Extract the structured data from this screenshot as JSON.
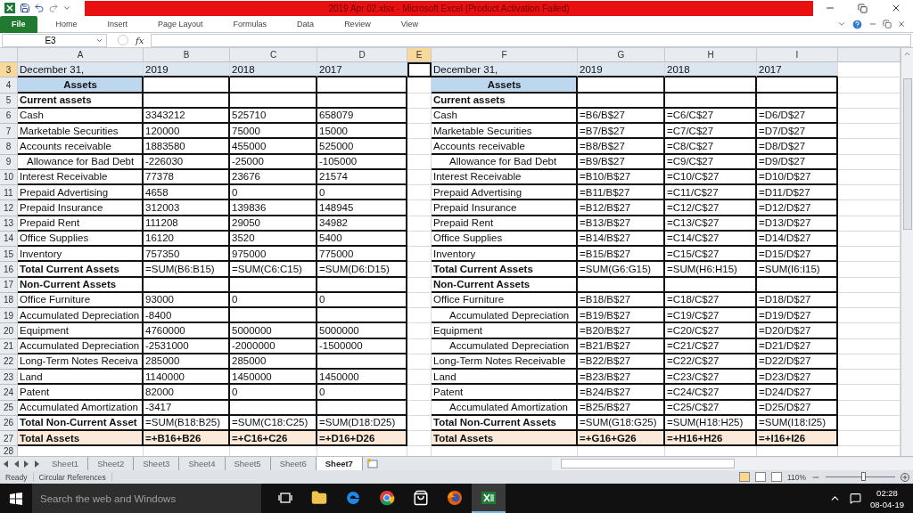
{
  "window": {
    "title": "2019 Apr 02.xlsx  -  Microsoft Excel (Product Activation Failed)"
  },
  "ribbon": {
    "tabs": [
      {
        "label": "File",
        "selected": true
      },
      {
        "label": "Home",
        "selected": false
      },
      {
        "label": "Insert",
        "selected": false
      },
      {
        "label": "Page Layout",
        "selected": false
      },
      {
        "label": "Formulas",
        "selected": false
      },
      {
        "label": "Data",
        "selected": false
      },
      {
        "label": "Review",
        "selected": false
      },
      {
        "label": "View",
        "selected": false
      }
    ]
  },
  "formula_bar": {
    "name_box": "E3",
    "function_label": "fx"
  },
  "columns": [
    {
      "label": "A",
      "selected": false
    },
    {
      "label": "B",
      "selected": false
    },
    {
      "label": "C",
      "selected": false
    },
    {
      "label": "D",
      "selected": false
    },
    {
      "label": "E",
      "selected": true
    },
    {
      "label": "F",
      "selected": false
    },
    {
      "label": "G",
      "selected": false
    },
    {
      "label": "H",
      "selected": false
    },
    {
      "label": "I",
      "selected": false
    }
  ],
  "rows": [
    {
      "number": "3",
      "kind": "header",
      "selected": true,
      "left": {
        "indent": false,
        "cells": [
          "December 31,",
          "2019",
          "2018",
          "2017"
        ]
      },
      "right": {
        "indent": false,
        "cells": [
          "December 31,",
          "2019",
          "2018",
          "2017"
        ]
      }
    },
    {
      "number": "4",
      "kind": "section",
      "selected": false,
      "left": {
        "indent": false,
        "cells": [
          "Assets",
          null,
          null,
          null
        ]
      },
      "right": {
        "indent": false,
        "cells": [
          "Assets",
          null,
          null,
          null
        ]
      }
    },
    {
      "number": "5",
      "kind": "subtotal",
      "selected": false,
      "left": {
        "indent": false,
        "cells": [
          "Current assets",
          null,
          null,
          null
        ]
      },
      "right": {
        "indent": false,
        "cells": [
          "Current assets",
          null,
          null,
          null
        ]
      }
    },
    {
      "number": "6",
      "kind": "plain",
      "selected": false,
      "left": {
        "indent": false,
        "cells": [
          "Cash",
          "3343212",
          "525710",
          "658079"
        ]
      },
      "right": {
        "indent": false,
        "cells": [
          "Cash",
          "=B6/B$27",
          "=C6/C$27",
          "=D6/D$27"
        ]
      }
    },
    {
      "number": "7",
      "kind": "plain",
      "selected": false,
      "left": {
        "indent": false,
        "cells": [
          "Marketable Securities",
          "120000",
          "75000",
          "15000"
        ]
      },
      "right": {
        "indent": false,
        "cells": [
          "Marketable Securities",
          "=B7/B$27",
          "=C7/C$27",
          "=D7/D$27"
        ]
      }
    },
    {
      "number": "8",
      "kind": "plain",
      "selected": false,
      "left": {
        "indent": false,
        "cells": [
          "Accounts receivable",
          "1883580",
          "455000",
          "525000"
        ]
      },
      "right": {
        "indent": false,
        "cells": [
          "Accounts receivable",
          "=B8/B$27",
          "=C8/C$27",
          "=D8/D$27"
        ]
      }
    },
    {
      "number": "9",
      "kind": "plain",
      "selected": false,
      "left": {
        "indent": true,
        "cells": [
          "Allowance for Bad Debt",
          "-226030",
          "-25000",
          "-105000"
        ]
      },
      "right": {
        "indent": true,
        "cells": [
          "Allowance for Bad Debt",
          "=B9/B$27",
          "=C9/C$27",
          "=D9/D$27"
        ]
      }
    },
    {
      "number": "10",
      "kind": "plain",
      "selected": false,
      "left": {
        "indent": false,
        "cells": [
          "Interest Receivable",
          "77378",
          "23676",
          "21574"
        ]
      },
      "right": {
        "indent": false,
        "cells": [
          "Interest Receivable",
          "=B10/B$27",
          "=C10/C$27",
          "=D10/D$27"
        ]
      }
    },
    {
      "number": "11",
      "kind": "plain",
      "selected": false,
      "left": {
        "indent": false,
        "cells": [
          "Prepaid Advertising",
          "4658",
          "0",
          "0"
        ]
      },
      "right": {
        "indent": false,
        "cells": [
          "Prepaid Advertising",
          "=B11/B$27",
          "=C11/C$27",
          "=D11/D$27"
        ]
      }
    },
    {
      "number": "12",
      "kind": "plain",
      "selected": false,
      "left": {
        "indent": false,
        "cells": [
          "Prepaid Insurance",
          "312003",
          "139836",
          "148945"
        ]
      },
      "right": {
        "indent": false,
        "cells": [
          "Prepaid Insurance",
          "=B12/B$27",
          "=C12/C$27",
          "=D12/D$27"
        ]
      }
    },
    {
      "number": "13",
      "kind": "plain",
      "selected": false,
      "left": {
        "indent": false,
        "cells": [
          "Prepaid Rent",
          "111208",
          "29050",
          "34982"
        ]
      },
      "right": {
        "indent": false,
        "cells": [
          "Prepaid Rent",
          "=B13/B$27",
          "=C13/C$27",
          "=D13/D$27"
        ]
      }
    },
    {
      "number": "14",
      "kind": "plain",
      "selected": false,
      "left": {
        "indent": false,
        "cells": [
          "Office Supplies",
          "16120",
          "3520",
          "5400"
        ]
      },
      "right": {
        "indent": false,
        "cells": [
          "Office Supplies",
          "=B14/B$27",
          "=C14/C$27",
          "=D14/D$27"
        ]
      }
    },
    {
      "number": "15",
      "kind": "plain",
      "selected": false,
      "left": {
        "indent": false,
        "cells": [
          "Inventory",
          "757350",
          "975000",
          "775000"
        ]
      },
      "right": {
        "indent": false,
        "cells": [
          "Inventory",
          "=B15/B$27",
          "=C15/C$27",
          "=D15/D$27"
        ]
      }
    },
    {
      "number": "16",
      "kind": "subtotal",
      "selected": false,
      "left": {
        "indent": false,
        "cells": [
          "Total Current Assets",
          "=SUM(B6:B15)",
          "=SUM(C6:C15)",
          "=SUM(D6:D15)"
        ]
      },
      "right": {
        "indent": false,
        "cells": [
          "Total Current Assets",
          "=SUM(G6:G15)",
          "=SUM(H6:H15)",
          "=SUM(I6:I15)"
        ]
      }
    },
    {
      "number": "17",
      "kind": "subtotal",
      "selected": false,
      "left": {
        "indent": false,
        "cells": [
          "Non-Current Assets",
          null,
          null,
          null
        ]
      },
      "right": {
        "indent": false,
        "cells": [
          "Non-Current Assets",
          null,
          null,
          null
        ]
      }
    },
    {
      "number": "18",
      "kind": "plain",
      "selected": false,
      "left": {
        "indent": false,
        "cells": [
          "Office Furniture",
          "93000",
          "0",
          "0"
        ]
      },
      "right": {
        "indent": false,
        "cells": [
          "Office Furniture",
          "=B18/B$27",
          "=C18/C$27",
          "=D18/D$27"
        ]
      }
    },
    {
      "number": "19",
      "kind": "plain",
      "selected": false,
      "left": {
        "indent": false,
        "cells": [
          "Accumulated Depreciation",
          "-8400",
          null,
          null
        ]
      },
      "right": {
        "indent": true,
        "cells": [
          "Accumulated Depreciation",
          "=B19/B$27",
          "=C19/C$27",
          "=D19/D$27"
        ]
      }
    },
    {
      "number": "20",
      "kind": "plain",
      "selected": false,
      "left": {
        "indent": false,
        "cells": [
          "Equipment",
          "4760000",
          "5000000",
          "5000000"
        ]
      },
      "right": {
        "indent": false,
        "cells": [
          "Equipment",
          "=B20/B$27",
          "=C20/C$27",
          "=D20/D$27"
        ]
      }
    },
    {
      "number": "21",
      "kind": "plain",
      "selected": false,
      "left": {
        "indent": false,
        "cells": [
          "Accumulated Depreciation",
          "-2531000",
          "-2000000",
          "-1500000"
        ]
      },
      "right": {
        "indent": true,
        "cells": [
          "Accumulated Depreciation",
          "=B21/B$27",
          "=C21/C$27",
          "=D21/D$27"
        ]
      }
    },
    {
      "number": "22",
      "kind": "plain",
      "selected": false,
      "left": {
        "indent": false,
        "cells": [
          "Long-Term Notes Receiva",
          "285000",
          "285000",
          null
        ]
      },
      "right": {
        "indent": false,
        "cells": [
          "Long-Term Notes Receivable",
          "=B22/B$27",
          "=C22/C$27",
          "=D22/D$27"
        ]
      }
    },
    {
      "number": "23",
      "kind": "plain",
      "selected": false,
      "left": {
        "indent": false,
        "cells": [
          "Land",
          "1140000",
          "1450000",
          "1450000"
        ]
      },
      "right": {
        "indent": false,
        "cells": [
          "Land",
          "=B23/B$27",
          "=C23/C$27",
          "=D23/D$27"
        ]
      }
    },
    {
      "number": "24",
      "kind": "plain",
      "selected": false,
      "left": {
        "indent": false,
        "cells": [
          "Patent",
          "82000",
          "0",
          "0"
        ]
      },
      "right": {
        "indent": false,
        "cells": [
          "Patent",
          "=B24/B$27",
          "=C24/C$27",
          "=D24/D$27"
        ]
      }
    },
    {
      "number": "25",
      "kind": "plain",
      "selected": false,
      "left": {
        "indent": false,
        "cells": [
          "Accumulated Amortization",
          "-3417",
          null,
          null
        ]
      },
      "right": {
        "indent": true,
        "cells": [
          "Accumulated Amortization",
          "=B25/B$27",
          "=C25/C$27",
          "=D25/D$27"
        ]
      }
    },
    {
      "number": "26",
      "kind": "subtotal",
      "selected": false,
      "left": {
        "indent": false,
        "cells": [
          "Total Non-Current Asset",
          "=SUM(B18:B25)",
          "=SUM(C18:C25)",
          "=SUM(D18:D25)"
        ]
      },
      "right": {
        "indent": false,
        "cells": [
          "Total Non-Current Assets",
          "=SUM(G18:G25)",
          "=SUM(H18:H25)",
          "=SUM(I18:I25)"
        ]
      }
    },
    {
      "number": "27",
      "kind": "total",
      "selected": false,
      "left": {
        "indent": false,
        "cells": [
          "Total Assets",
          "=+B16+B26",
          "=+C16+C26",
          "=+D16+D26"
        ]
      },
      "right": {
        "indent": false,
        "cells": [
          "Total Assets",
          "=+G16+G26",
          "=+H16+H26",
          "=+I16+I26"
        ]
      }
    },
    {
      "number": "28",
      "kind": "empty",
      "selected": false,
      "left": {
        "indent": false,
        "cells": [
          null,
          null,
          null,
          null
        ]
      },
      "right": {
        "indent": false,
        "cells": [
          null,
          null,
          null,
          null
        ]
      }
    }
  ],
  "sheet_tabs": [
    {
      "label": "Sheet1",
      "selected": false
    },
    {
      "label": "Sheet2",
      "selected": false
    },
    {
      "label": "Sheet3",
      "selected": false
    },
    {
      "label": "Sheet4",
      "selected": false
    },
    {
      "label": "Sheet5",
      "selected": false
    },
    {
      "label": "Sheet6",
      "selected": false
    },
    {
      "label": "Sheet7",
      "selected": true
    }
  ],
  "status_bar": {
    "items": [
      "Ready",
      "Circular References"
    ],
    "zoom": {
      "reading": "110%",
      "level": 0.55
    }
  },
  "taskbar": {
    "search": {
      "placeholder": "Search the web and Windows"
    },
    "apps": [
      {
        "kind": "taskview",
        "selected": false
      },
      {
        "kind": "folder",
        "selected": false
      },
      {
        "kind": "edge",
        "selected": false
      },
      {
        "kind": "chrome",
        "selected": false
      },
      {
        "kind": "store",
        "selected": false
      },
      {
        "kind": "firefox",
        "selected": false
      },
      {
        "kind": "excel",
        "selected": true
      }
    ],
    "time": "02:28",
    "date": "08-04-19"
  }
}
